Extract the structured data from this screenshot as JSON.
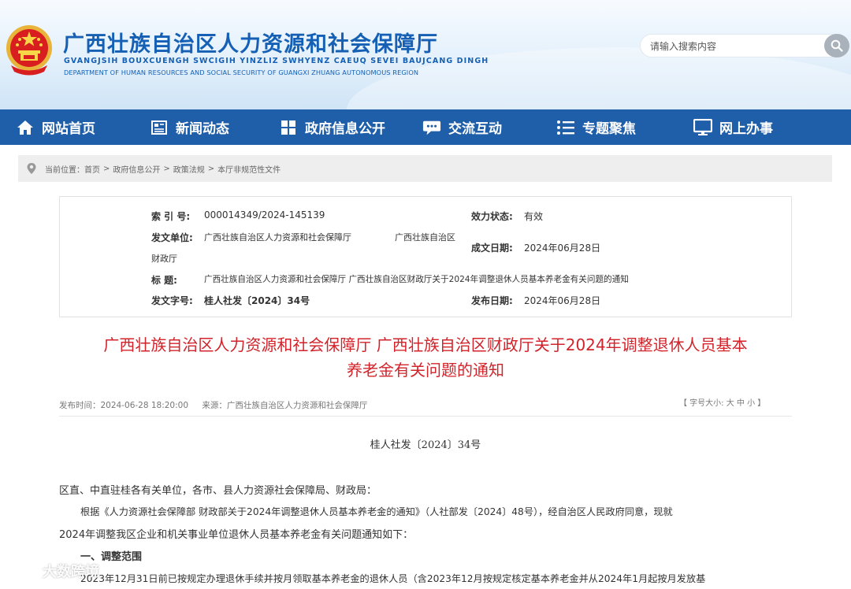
{
  "header": {
    "site_title": "广西壮族自治区人力资源和社会保障厅",
    "site_zhuang": "GVANGJSIH BOUXCUENGH SWCIGIH YINZLIZ SWHYENZ CAEUQ SEVEI BAUJCANG DINGH",
    "site_en": "DEPARTMENT OF HUMAN RESOURCES AND SOCIAL SECURITY OF GUANGXI ZHUANG AUTONOMOUS REGION",
    "search_placeholder": "请输入搜索内容"
  },
  "nav": [
    {
      "label": "网站首页",
      "icon": "home-icon"
    },
    {
      "label": "新闻动态",
      "icon": "news-icon"
    },
    {
      "label": "政府信息公开",
      "icon": "grid-icon"
    },
    {
      "label": "交流互动",
      "icon": "chat-icon"
    },
    {
      "label": "专题聚焦",
      "icon": "list-icon"
    },
    {
      "label": "网上办事",
      "icon": "monitor-icon"
    }
  ],
  "breadcrumb": {
    "prefix": "当前位置：",
    "items": [
      "首页",
      "政府信息公开",
      "政策法规",
      "本厅非规范性文件"
    ],
    "separator": ">"
  },
  "info": {
    "index_label": "索  引  号:",
    "index_value": "000014349/2024-145139",
    "status_label": "效力状态:",
    "status_value": "有效",
    "issuer_label": "发文单位:",
    "issuer_value_1": "广西壮族自治区人力资源和社会保障厅",
    "issuer_value_2": "广西壮族自治区",
    "issuer_value_3": "财政厅",
    "created_label": "成文日期:",
    "created_value": "2024年06月28日",
    "title_label": "标      题:",
    "title_value": "广西壮族自治区人力资源和社会保障厅 广西壮族自治区财政厅关于2024年调整退休人员基本养老金有关问题的通知",
    "docno_label": "发文字号:",
    "docno_value": "桂人社发〔2024〕34号",
    "published_label": "发布日期:",
    "published_value": "2024年06月28日"
  },
  "article": {
    "title_line1": "广西壮族自治区人力资源和社会保障厅 广西壮族自治区财政厅关于2024年调整退休人员基本",
    "title_line2": "养老金有关问题的通知",
    "publish_time": "发布时间：2024-06-28 18:20:00",
    "source": "来源：广西壮族自治区人力资源和社会保障厅",
    "font_size_ctrl": "【 字号大小: 大  中  小 】",
    "doc_number": "桂人社发〔2024〕34号",
    "addressee": "区直、中直驻桂各有关单位，各市、县人力资源社会保障局、财政局：",
    "para1_line1": "根据《人力资源社会保障部 财政部关于2024年调整退休人员基本养老金的通知》（人社部发〔2024〕48号），经自治区人民政府同意，现就",
    "para1_line2": "2024年调整我区企业和机关事业单位退休人员基本养老金有关问题通知如下：",
    "section1": "一、调整范围",
    "para2_line1": "2023年12月31日前已按规定办理退休手续并按月领取基本养老金的退休人员（含2023年12月按规定核定基本养老金并从2024年1月起按月发放基"
  },
  "watermark": "大数跨境",
  "colors": {
    "nav_bg": "#1f5ea8",
    "title_blue": "#1560b5",
    "article_title_red": "#d3232a"
  }
}
